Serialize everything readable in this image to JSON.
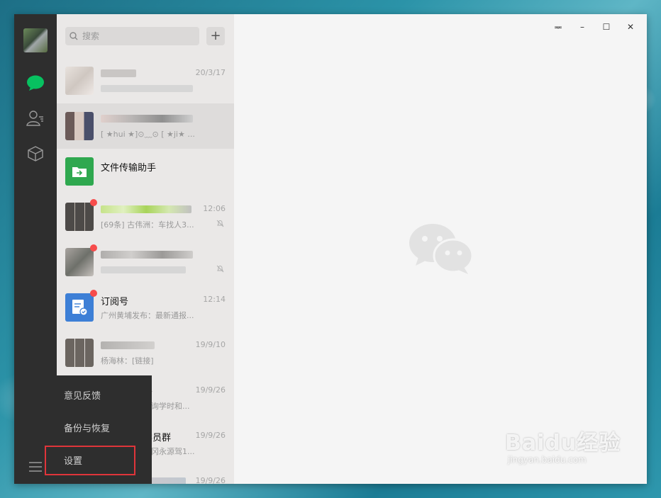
{
  "search": {
    "placeholder": "搜索"
  },
  "add_label": "+",
  "window_controls": {
    "pin": "ᆓ",
    "minimize": "–",
    "maximize": "☐",
    "close": "✕"
  },
  "conversations": [
    {
      "name": "",
      "time": "20/3/17",
      "msg": "",
      "dot": false
    },
    {
      "name": "",
      "time": "",
      "msg": "[ ★hui ★]⊙﹏⊙ [ ★ji★ ...",
      "dot": false
    },
    {
      "name": "文件传输助手",
      "time": "",
      "msg": "",
      "dot": false
    },
    {
      "name": "",
      "time": "12:06",
      "msg": "[69条] 古伟洲：车找人3...",
      "dot": true,
      "muted": true
    },
    {
      "name": "",
      "time": "",
      "msg": "",
      "dot": true,
      "muted": true
    },
    {
      "name": "订阅号",
      "time": "12:14",
      "msg": "广州黄埔发布：最新通报...",
      "dot": true
    },
    {
      "name": "",
      "time": "19/9/10",
      "msg": "杨海林：[链接]",
      "dot": false
    },
    {
      "name": "务",
      "time": "19/9/26",
      "msg": "查询学时和...",
      "dot": false
    },
    {
      "name": "学员群",
      "time": "19/9/26",
      "msg": "军冈永源驾1...",
      "dot": false
    },
    {
      "name": "",
      "time": "19/9/26",
      "msg": "",
      "dot": false
    }
  ],
  "menu": {
    "feedback": "意见反馈",
    "backup": "备份与恢复",
    "settings": "设置"
  },
  "watermark": {
    "brand": "Baidu经验",
    "url": "jingyan.baidu.com"
  },
  "colors": {
    "nav_bg": "#2e2e2e",
    "accent_green": "#07c160",
    "badge_red": "#f74c4c",
    "highlight_red": "#e0353a"
  }
}
